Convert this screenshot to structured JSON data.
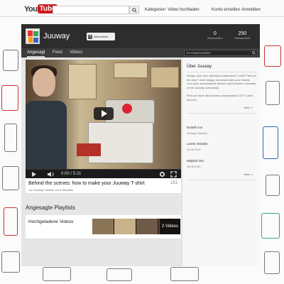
{
  "topbar": {
    "logo_you": "You",
    "logo_tube": "Tube",
    "search_placeholder": "",
    "links": [
      "Kategorien",
      "Video hochladen",
      "Konto erstellen",
      "Anmelden"
    ]
  },
  "channel": {
    "name": "Juuway",
    "subscribe_label": "Abonnieren",
    "subscribers_count": "0",
    "subscribers_label": "Abonnenten",
    "views_count": "250",
    "views_label": "Videoaufrufe"
  },
  "nav": {
    "tabs": [
      "Angesagt",
      "Feed",
      "Videos"
    ],
    "active_tab": "Angesagt",
    "search_placeholder": "Im Kanal suchen"
  },
  "video": {
    "time_current": "0:00",
    "time_total": "5:21",
    "title": "Behind the scenes: how to make your Juuway T-shirt",
    "meta": "von Juuway Fashion vor 6 Monaten",
    "views": "151"
  },
  "playlists": {
    "heading": "Angesagte Playlists",
    "items": [
      {
        "title": "Hochgeladene Videos",
        "count_label": "2 Videos"
      }
    ]
  },
  "sidebar": {
    "about_heading": "Über Juuway",
    "about_text_1": "Design your own individual customised T-shirt! Find out the best T-shirt design and share with your friends. Love your personalized fashion and become a member of the Juuway community.",
    "about_text_2": "Find out more about mass customization, DIY T-shirt and ecc.",
    "more_label": "Mehr »",
    "created_label": "Erstellt von",
    "created_value": "Juuway Fashion",
    "last_activity_label": "Letzte Aktivität",
    "last_activity_value": "16.06.2011",
    "member_since_label": "Mitglied seit",
    "member_since_value": "08.06.2011",
    "more_label_2": "Mehr »"
  },
  "colors": {
    "brand_red": "#cc181e",
    "header_dark": "#2d2d2d",
    "nav_dark": "#3b3b3b"
  }
}
